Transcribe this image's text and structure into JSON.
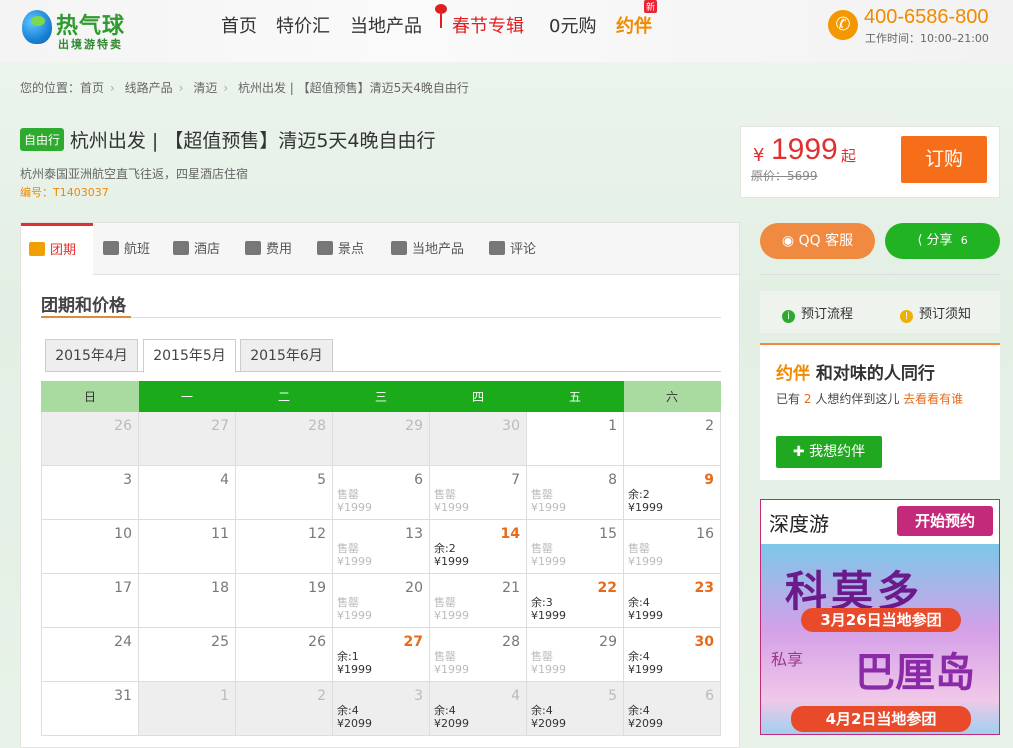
{
  "header": {
    "logo_main": "热气球",
    "logo_sub": "出境游特卖",
    "nav": [
      "首页",
      "特价汇",
      "当地产品",
      "春节专辑",
      "0元购",
      "约伴"
    ],
    "new_badge": "新",
    "phone": "400-6586-800",
    "work_time": "工作时间：10:00–21:00"
  },
  "breadcrumb": [
    "您的位置：首页",
    "线路产品",
    "清迈",
    "杭州出发 | 【超值预售】清迈5天4晚自由行"
  ],
  "product": {
    "tag": "自由行",
    "title": "杭州出发 | 【超值预售】清迈5天4晚自由行",
    "subtitle": "杭州泰国亚洲航空直飞往返，四星酒店住宿",
    "code": "编号：T1403037"
  },
  "price": {
    "currency": "¥",
    "value": "1999",
    "suffix": "起",
    "original": "原价：5699",
    "order_button": "订购"
  },
  "tabs": [
    "团期",
    "航班",
    "酒店",
    "费用",
    "景点",
    "当地产品",
    "评论"
  ],
  "section_title": "团期和价格",
  "month_tabs": [
    "2015年4月",
    "2015年5月",
    "2015年6月"
  ],
  "weekdays": [
    "日",
    "一",
    "二",
    "三",
    "四",
    "五",
    "六"
  ],
  "calendar": [
    [
      {
        "d": "26",
        "o": 1
      },
      {
        "d": "27",
        "o": 1
      },
      {
        "d": "28",
        "o": 1
      },
      {
        "d": "29",
        "o": 1
      },
      {
        "d": "30",
        "o": 1
      },
      {
        "d": "1"
      },
      {
        "d": "2"
      }
    ],
    [
      {
        "d": "3"
      },
      {
        "d": "4"
      },
      {
        "d": "5"
      },
      {
        "d": "6",
        "s": "售罄",
        "p": "¥1999",
        "x": 1
      },
      {
        "d": "7",
        "s": "售罄",
        "p": "¥1999",
        "x": 1
      },
      {
        "d": "8",
        "s": "售罄",
        "p": "¥1999",
        "x": 1
      },
      {
        "d": "9",
        "s": "余:2",
        "p": "¥1999",
        "h": 1
      }
    ],
    [
      {
        "d": "10"
      },
      {
        "d": "11"
      },
      {
        "d": "12"
      },
      {
        "d": "13",
        "s": "售罄",
        "p": "¥1999",
        "x": 1
      },
      {
        "d": "14",
        "s": "余:2",
        "p": "¥1999",
        "h": 1
      },
      {
        "d": "15",
        "s": "售罄",
        "p": "¥1999",
        "x": 1
      },
      {
        "d": "16",
        "s": "售罄",
        "p": "¥1999",
        "x": 1
      }
    ],
    [
      {
        "d": "17"
      },
      {
        "d": "18"
      },
      {
        "d": "19"
      },
      {
        "d": "20",
        "s": "售罄",
        "p": "¥1999",
        "x": 1
      },
      {
        "d": "21",
        "s": "售罄",
        "p": "¥1999",
        "x": 1
      },
      {
        "d": "22",
        "s": "余:3",
        "p": "¥1999",
        "h": 1
      },
      {
        "d": "23",
        "s": "余:4",
        "p": "¥1999",
        "h": 1
      }
    ],
    [
      {
        "d": "24"
      },
      {
        "d": "25"
      },
      {
        "d": "26"
      },
      {
        "d": "27",
        "s": "余:1",
        "p": "¥1999",
        "h": 1
      },
      {
        "d": "28",
        "s": "售罄",
        "p": "¥1999",
        "x": 1
      },
      {
        "d": "29",
        "s": "售罄",
        "p": "¥1999",
        "x": 1
      },
      {
        "d": "30",
        "s": "余:4",
        "p": "¥1999",
        "h": 1
      }
    ],
    [
      {
        "d": "31"
      },
      {
        "d": "1",
        "o": 1
      },
      {
        "d": "2",
        "o": 1
      },
      {
        "d": "3",
        "o": 1,
        "s": "余:4",
        "p": "¥2099"
      },
      {
        "d": "4",
        "o": 1,
        "s": "余:4",
        "p": "¥2099"
      },
      {
        "d": "5",
        "o": 1,
        "s": "余:4",
        "p": "¥2099"
      },
      {
        "d": "6",
        "o": 1,
        "s": "余:4",
        "p": "¥2099"
      }
    ]
  ],
  "side": {
    "qq_label": "QQ 客服",
    "share_label": "分享",
    "share_count": "6",
    "process": "预订流程",
    "notice": "预订须知",
    "yueban_logo": "约伴",
    "yueban_title": "和对味的人同行",
    "yueban_text_a": "已有",
    "yueban_count": "2",
    "yueban_text_b": "人想约伴到这儿",
    "yueban_link": "去看看有谁",
    "yueban_button": "我想约伴"
  },
  "banner": {
    "brand": "深度游",
    "cta": "开始预约",
    "place1": "科莫多",
    "date1": "3月26日当地参团",
    "prefix2": "私享",
    "place2": "巴厘岛",
    "date2": "4月2日当地参团"
  }
}
